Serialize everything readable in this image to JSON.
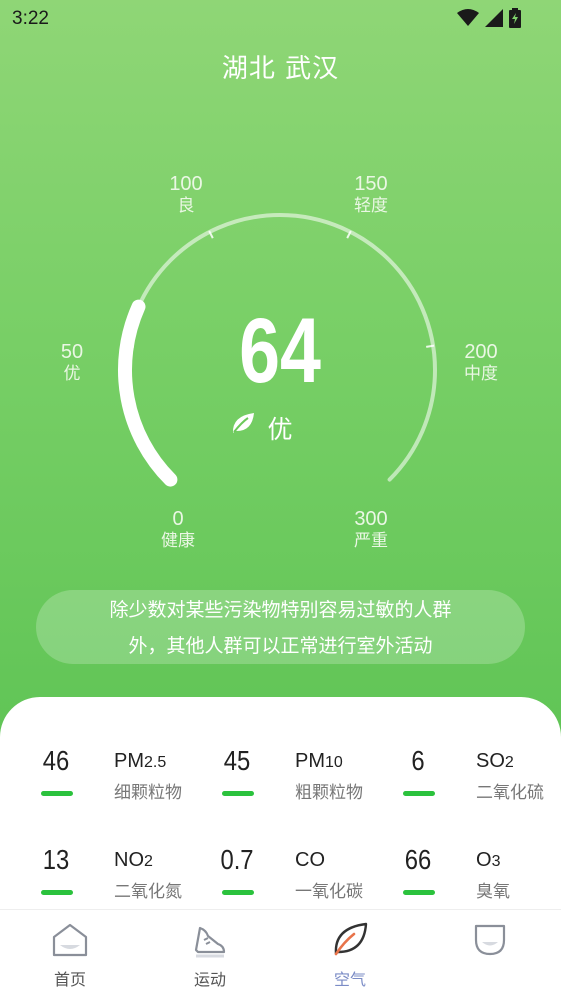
{
  "status_bar": {
    "time": "3:22"
  },
  "location": {
    "city": "湖北 武汉"
  },
  "aqi": {
    "value": "64",
    "value_num": 64,
    "max": 300,
    "level": "优",
    "advice_line1": "除少数对某些污染物特别容易过敏的人群",
    "advice_line2": "外，其他人群可以正常进行室外活动",
    "scale": [
      {
        "value": "0",
        "label": "健康"
      },
      {
        "value": "50",
        "label": "优"
      },
      {
        "value": "100",
        "label": "良"
      },
      {
        "value": "150",
        "label": "轻度"
      },
      {
        "value": "200",
        "label": "中度"
      },
      {
        "value": "300",
        "label": "严重"
      }
    ]
  },
  "pollutants": [
    {
      "value": "46",
      "code": "PM",
      "code_sub": "2.5",
      "name": "细颗粒物"
    },
    {
      "value": "45",
      "code": "PM",
      "code_sub": "10",
      "name": "粗颗粒物"
    },
    {
      "value": "6",
      "code": "SO",
      "code_sub": "2",
      "name": "二氧化硫"
    },
    {
      "value": "13",
      "code": "NO",
      "code_sub": "2",
      "name": "二氧化氮"
    },
    {
      "value": "0.7",
      "code": "CO",
      "code_sub": "",
      "name": "一氧化碳"
    },
    {
      "value": "66",
      "code": "O",
      "code_sub": "3",
      "name": "臭氧"
    }
  ],
  "tabs": [
    {
      "label": "首页",
      "icon": "home-icon",
      "active": false
    },
    {
      "label": "运动",
      "icon": "sneaker-icon",
      "active": false
    },
    {
      "label": "空气",
      "icon": "leaf-icon",
      "active": true
    },
    {
      "label": "",
      "icon": "profile-icon",
      "active": false
    }
  ],
  "colors": {
    "accent": "#2bc23d",
    "hero_top": "#8fd676",
    "hero_bottom": "#5fc455",
    "tab_active": "#7b8cc6"
  }
}
